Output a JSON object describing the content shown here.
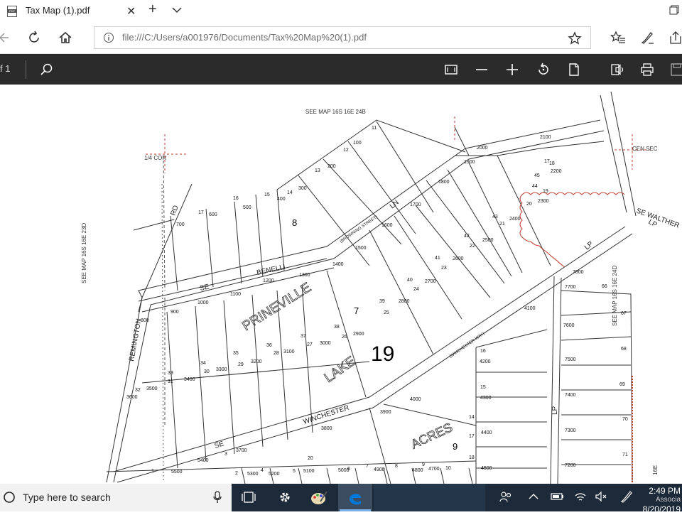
{
  "browser": {
    "tab_title": "Tax Map (1).pdf",
    "url": "file:///C:/Users/a001976/Documents/Tax%20Map%20(1).pdf"
  },
  "pdf_toolbar": {
    "page_indicator": "f 1"
  },
  "map": {
    "header": "SEE    MAP    16S    16E    24B",
    "left_ref": "SEE    MAP    16S    16E    23D",
    "right_ref_top": "SEE    MAP    16S    16E    24D",
    "right_ref_bottom": "16E",
    "quarter_corner": "1/4 COR",
    "center_section": "CEN SEC",
    "section_number": "19",
    "block_8": "8",
    "block_7": "7",
    "block_9": "9",
    "streets": {
      "rd": "RD",
      "benelli_se": "SE",
      "benelli": "BENELLI",
      "ln": "LN",
      "browning": "(BROWNING STREET)",
      "remington": "REMINGTON",
      "winchester_se": "SE",
      "winchester": "WINCHESTER",
      "winchester_way": "(WINCHESTER WAY)",
      "walther": "SE WALTHER",
      "walther_lp": "LP",
      "lp_1": "LP",
      "lp_2": "LP"
    },
    "subdivision": {
      "word1": "PRINEVILLE",
      "word2": "LAKE",
      "word3": "ACRES"
    },
    "lots": [
      {
        "label": "11"
      },
      {
        "label": "100"
      },
      {
        "label": "12"
      },
      {
        "label": "200"
      },
      {
        "label": "13"
      },
      {
        "label": "300"
      },
      {
        "label": "14"
      },
      {
        "label": "400"
      },
      {
        "label": "15"
      },
      {
        "label": "500"
      },
      {
        "label": "16"
      },
      {
        "label": "600"
      },
      {
        "label": "17"
      },
      {
        "label": "700"
      },
      {
        "label": "2000"
      },
      {
        "label": "2100"
      },
      {
        "label": "17"
      },
      {
        "label": "18"
      },
      {
        "label": "2200"
      },
      {
        "label": "1900"
      },
      {
        "label": "1800"
      },
      {
        "label": "1700"
      },
      {
        "label": "1600"
      },
      {
        "label": "1500"
      },
      {
        "label": "1400"
      },
      {
        "label": "1300"
      },
      {
        "label": "1200"
      },
      {
        "label": "1100"
      },
      {
        "label": "1000"
      },
      {
        "label": "900"
      },
      {
        "label": "800"
      },
      {
        "label": "45"
      },
      {
        "label": "44"
      },
      {
        "label": "19"
      },
      {
        "label": "20"
      },
      {
        "label": "2300"
      },
      {
        "label": "43"
      },
      {
        "label": "21"
      },
      {
        "label": "2400"
      },
      {
        "label": "42"
      },
      {
        "label": "22"
      },
      {
        "label": "2500"
      },
      {
        "label": "41"
      },
      {
        "label": "23"
      },
      {
        "label": "2600"
      },
      {
        "label": "40"
      },
      {
        "label": "24"
      },
      {
        "label": "2700"
      },
      {
        "label": "39"
      },
      {
        "label": "25"
      },
      {
        "label": "2800"
      },
      {
        "label": "38"
      },
      {
        "label": "26"
      },
      {
        "label": "2900"
      },
      {
        "label": "37"
      },
      {
        "label": "27"
      },
      {
        "label": "3000"
      },
      {
        "label": "36"
      },
      {
        "label": "28"
      },
      {
        "label": "3100"
      },
      {
        "label": "35"
      },
      {
        "label": "29"
      },
      {
        "label": "3200"
      },
      {
        "label": "34"
      },
      {
        "label": "30"
      },
      {
        "label": "3300"
      },
      {
        "label": "33"
      },
      {
        "label": "31"
      },
      {
        "label": "3400"
      },
      {
        "label": "32"
      },
      {
        "label": "3500"
      },
      {
        "label": "3600"
      },
      {
        "label": "7800"
      },
      {
        "label": "66"
      },
      {
        "label": "7700"
      },
      {
        "label": "4100"
      },
      {
        "label": "67"
      },
      {
        "label": "7600"
      },
      {
        "label": "68"
      },
      {
        "label": "16"
      },
      {
        "label": "4200"
      },
      {
        "label": "7500"
      },
      {
        "label": "15"
      },
      {
        "label": "4300"
      },
      {
        "label": "69"
      },
      {
        "label": "7400"
      },
      {
        "label": "4000"
      },
      {
        "label": "3900"
      },
      {
        "label": "14"
      },
      {
        "label": "4400"
      },
      {
        "label": "70"
      },
      {
        "label": "7300"
      },
      {
        "label": "17"
      },
      {
        "label": "3800"
      },
      {
        "label": "3700"
      },
      {
        "label": "3"
      },
      {
        "label": "5400"
      },
      {
        "label": "18"
      },
      {
        "label": "71"
      },
      {
        "label": "4500"
      },
      {
        "label": "7200"
      },
      {
        "label": "1"
      },
      {
        "label": "5500"
      },
      {
        "label": "2"
      },
      {
        "label": "5300"
      },
      {
        "label": "4"
      },
      {
        "label": "5200"
      },
      {
        "label": "20"
      },
      {
        "label": "5"
      },
      {
        "label": "5100"
      },
      {
        "label": "6"
      },
      {
        "label": "5000"
      },
      {
        "label": "7"
      },
      {
        "label": "4900"
      },
      {
        "label": "8"
      },
      {
        "label": "4800"
      },
      {
        "label": "9"
      },
      {
        "label": "4700"
      },
      {
        "label": "10"
      }
    ]
  },
  "taskbar": {
    "search_placeholder": "Type here to search",
    "time": "2:49 PM",
    "date": "8/20/2019",
    "assoc": "Associa"
  },
  "colors": {
    "pdf_toolbar": "#2b2b2b",
    "taskbar": "#1c2a3a",
    "boundary_red": "#c0392b",
    "edge_blue": "#0078d7"
  }
}
